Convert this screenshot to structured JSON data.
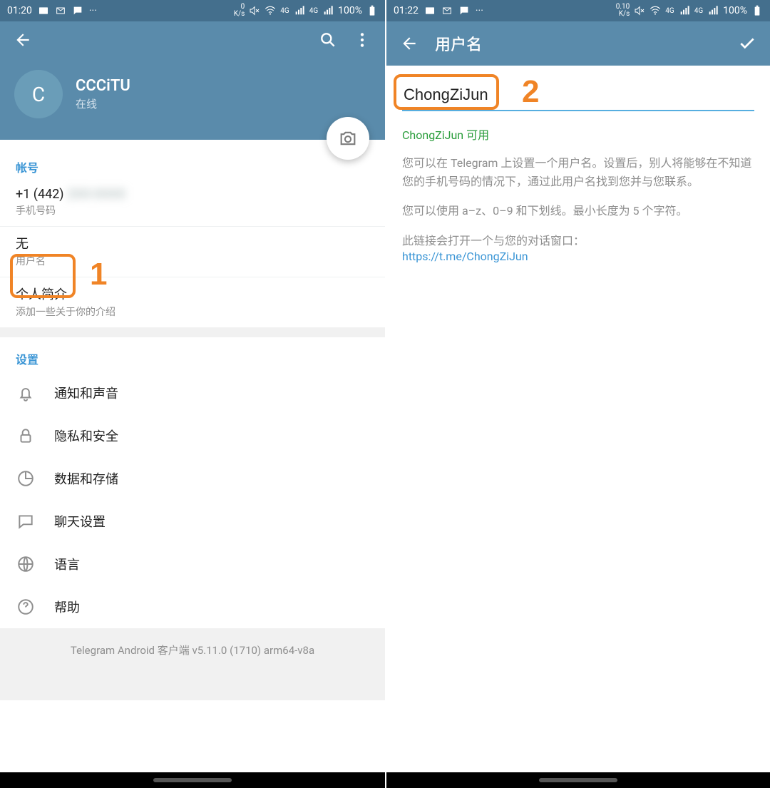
{
  "left": {
    "statusbar": {
      "time": "01:20",
      "speed": "0\nK/s",
      "net": "4G",
      "battery": "100%"
    },
    "profile": {
      "avatar_letter": "C",
      "name": "CCCiTU",
      "status": "在线"
    },
    "account_header": "帐号",
    "phone": {
      "value": "+1 (442)",
      "blurred": "2XX-XXXX",
      "label": "手机号码"
    },
    "username": {
      "value": "无",
      "label": "用户名"
    },
    "bio": {
      "value": "个人简介",
      "label": "添加一些关于你的介绍"
    },
    "settings_header": "设置",
    "settings": [
      {
        "id": "notifications",
        "label": "通知和声音"
      },
      {
        "id": "privacy",
        "label": "隐私和安全"
      },
      {
        "id": "data",
        "label": "数据和存储"
      },
      {
        "id": "chat",
        "label": "聊天设置"
      },
      {
        "id": "language",
        "label": "语言"
      },
      {
        "id": "help",
        "label": "帮助"
      }
    ],
    "version": "Telegram Android 客户端 v5.11.0 (1710) arm64-v8a",
    "annotation": "1"
  },
  "right": {
    "statusbar": {
      "time": "01:22",
      "speed": "0.10\nK/s",
      "net": "4G",
      "battery": "100%"
    },
    "appbar_title": "用户名",
    "input_value": "ChongZiJun",
    "availability": "ChongZiJun 可用",
    "desc1": "您可以在 Telegram 上设置一个用户名。设置后，别人将能够在不知道您的手机号码的情况下，通过此用户名找到您并与您联系。",
    "desc2": "您可以使用 a–z、0–9 和下划线。最小长度为 5 个字符。",
    "desc3": "此链接会打开一个与您的对话窗口：",
    "link": "https://t.me/ChongZiJun",
    "annotation": "2"
  }
}
